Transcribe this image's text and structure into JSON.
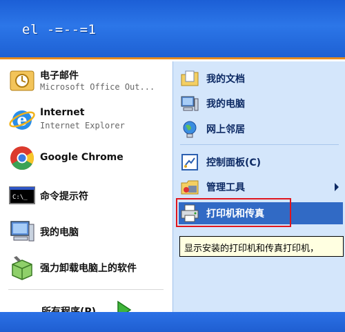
{
  "header": {
    "user": "el -=--=1"
  },
  "left": {
    "pinned": [
      {
        "title": "电子邮件",
        "subtitle": "Microsoft Office Out..."
      },
      {
        "title": "Internet",
        "subtitle": "Internet Explorer"
      }
    ],
    "recent": [
      {
        "title": "Google Chrome"
      },
      {
        "title": "命令提示符"
      },
      {
        "title": "我的电脑"
      },
      {
        "title": "强力卸载电脑上的软件"
      }
    ],
    "all_programs": "所有程序(P)"
  },
  "right": {
    "items": [
      {
        "label": "我的文档"
      },
      {
        "label": "我的电脑"
      },
      {
        "label": "网上邻居"
      },
      {
        "label": "控制面板(C)"
      },
      {
        "label": "管理工具"
      },
      {
        "label": "打印机和传真"
      }
    ],
    "tooltip": "显示安装的打印机和传真打印机，"
  },
  "colors": {
    "header_blue": "#2c76e8",
    "highlight": "#316ac5",
    "orange_bar": "#e58b1e",
    "red_box": "#e0141c"
  }
}
